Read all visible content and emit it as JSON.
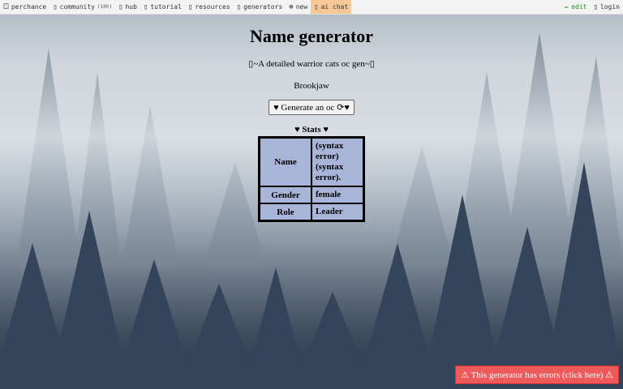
{
  "topbar": {
    "items": [
      {
        "icon": "⛋",
        "icon_name": "perchance-logo-icon",
        "label": "perchance"
      },
      {
        "icon": "▯",
        "icon_name": "community-icon",
        "label": "community",
        "badge": "(10h)"
      },
      {
        "icon": "▯",
        "icon_name": "hub-icon",
        "label": "hub"
      },
      {
        "icon": "▯",
        "icon_name": "tutorial-icon",
        "label": "tutorial"
      },
      {
        "icon": "▯",
        "icon_name": "resources-icon",
        "label": "resources"
      },
      {
        "icon": "▯",
        "icon_name": "generators-icon",
        "label": "generators"
      },
      {
        "icon": "⊕",
        "icon_name": "new-plus-icon",
        "label": "new"
      },
      {
        "icon": "▯",
        "icon_name": "ai-chat-icon",
        "label": "ai chat"
      }
    ],
    "edit": {
      "icon": "✏",
      "label": "edit"
    },
    "login": {
      "icon": "▯",
      "label": "login"
    }
  },
  "page": {
    "title": "Name generator",
    "subtitle": "▯~A detailed warrior cats oc gen~▯",
    "result": "Brookjaw",
    "generate_button": "♥ Generate an oc ⟳♥",
    "stats_title": "♥ Stats ♥"
  },
  "stats": [
    {
      "key": "Name",
      "value": "(syntax error) (syntax error)."
    },
    {
      "key": "Gender",
      "value": "female"
    },
    {
      "key": "Role",
      "value": "Leader"
    }
  ],
  "error_banner": "⚠ This generator has errors (click here) ⚠",
  "colors": {
    "table_bg": "#a8b4d8",
    "chat_highlight": "#f5c896",
    "error_bg": "#ee5a5a",
    "edit_green": "#2e8b2e"
  }
}
